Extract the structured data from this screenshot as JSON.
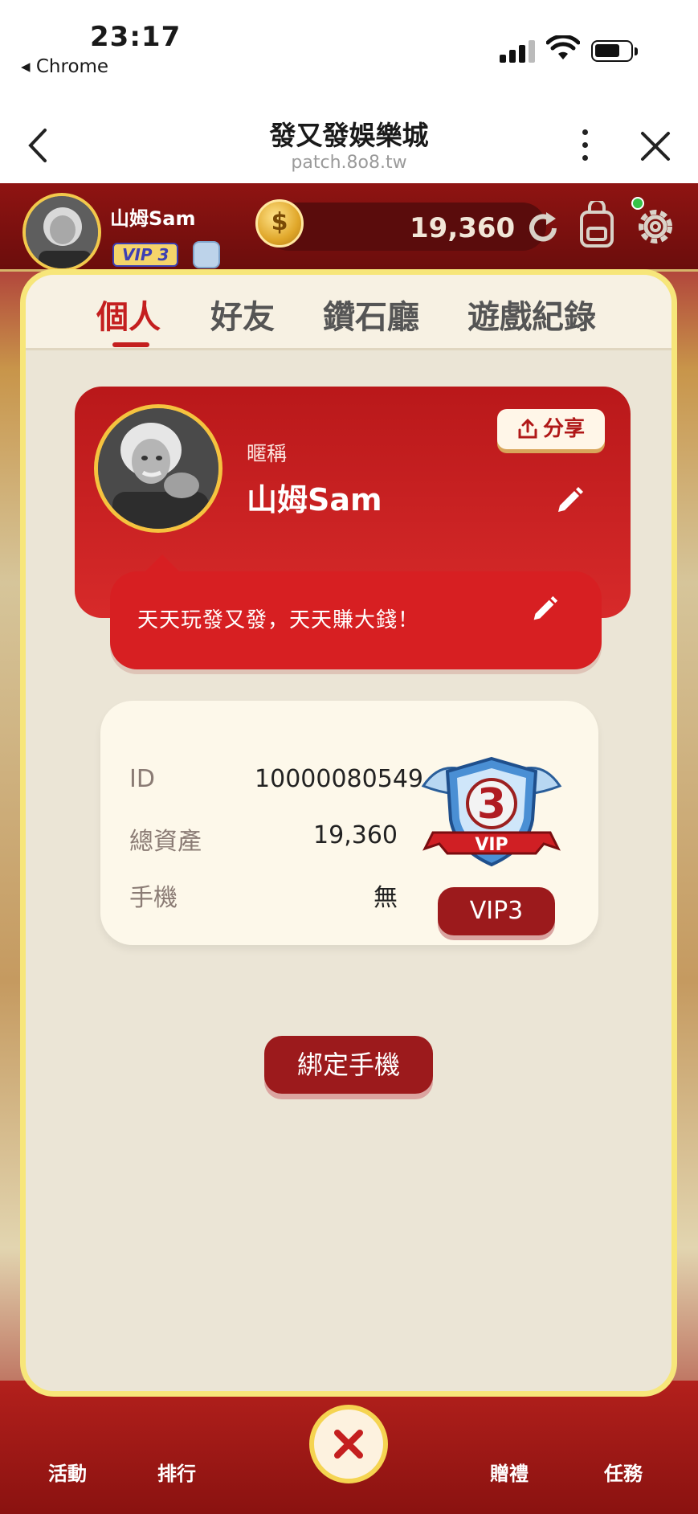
{
  "status_bar": {
    "time": "23:17",
    "back_app": "◂ Chrome"
  },
  "browser": {
    "title": "發又發娛樂城",
    "url": "patch.8o8.tw"
  },
  "game_header": {
    "player_name": "山姆Sam",
    "vip_tag": "VIP 3",
    "coin_symbol": "$",
    "balance": "19,360"
  },
  "bottom_nav": {
    "items": [
      "活動",
      "排行",
      "贈禮",
      "任務"
    ]
  },
  "modal": {
    "tabs": [
      "個人",
      "好友",
      "鑽石廳",
      "遊戲紀錄"
    ],
    "profile": {
      "nickname_label": "暱稱",
      "nickname": "山姆Sam",
      "share_label": "分享",
      "motto": "天天玩發又發，天天賺大錢！"
    },
    "info": {
      "rows": [
        {
          "label": "ID",
          "value": "10000080549"
        },
        {
          "label": "總資產",
          "value": "19,360"
        },
        {
          "label": "手機",
          "value": "無"
        }
      ],
      "vip_number": "3",
      "vip_ribbon": "VIP",
      "vip_button": "VIP3"
    },
    "bind_button": "綁定手機"
  },
  "colors": {
    "accent_red": "#c41f1f",
    "card_red": "#d71f22",
    "button_red": "#9c1a1c",
    "frame_yellow": "#f7e67a",
    "modal_bg": "#ebe5d6"
  },
  "icons": [
    "chevron-left-icon",
    "more-vertical-icon",
    "close-icon",
    "coin-icon",
    "refresh-icon",
    "bag-icon",
    "gear-icon",
    "share-icon",
    "pencil-icon",
    "vip-shield-icon"
  ]
}
